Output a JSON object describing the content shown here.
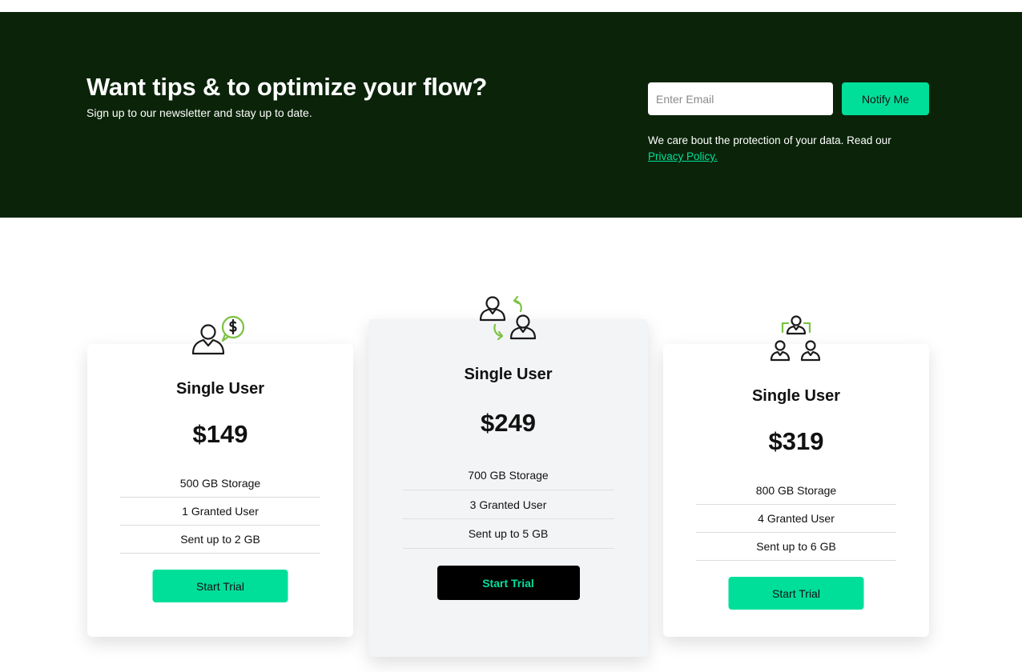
{
  "newsletter": {
    "title": "Want tips & to optimize your flow?",
    "subtitle": "Sign up to our newsletter and stay up to date.",
    "email_placeholder": "Enter Email",
    "notify_label": "Notify Me",
    "privacy_text": "We care bout the protection of your data. Read our",
    "privacy_link": "Privacy Policy."
  },
  "plans": [
    {
      "icon": "user-dollar-icon",
      "name": "Single User",
      "price": "$149",
      "features": [
        "500 GB Storage",
        "1 Granted User",
        "Sent up to 2 GB"
      ],
      "cta": "Start Trial"
    },
    {
      "icon": "users-exchange-icon",
      "name": "Single User",
      "price": "$249",
      "features": [
        "700 GB Storage",
        "3 Granted User",
        "Sent up to 5 GB"
      ],
      "cta": "Start Trial"
    },
    {
      "icon": "user-group-icon",
      "name": "Single User",
      "price": "$319",
      "features": [
        "800 GB Storage",
        "4 Granted User",
        "Sent up to 6 GB"
      ],
      "cta": "Start Trial"
    }
  ],
  "colors": {
    "newsletter_bg": "#0b2409",
    "accent": "#00df9a",
    "icon_accent": "#7cc242",
    "featured_card_bg": "#f3f4f6",
    "dark_button": "#000000"
  }
}
